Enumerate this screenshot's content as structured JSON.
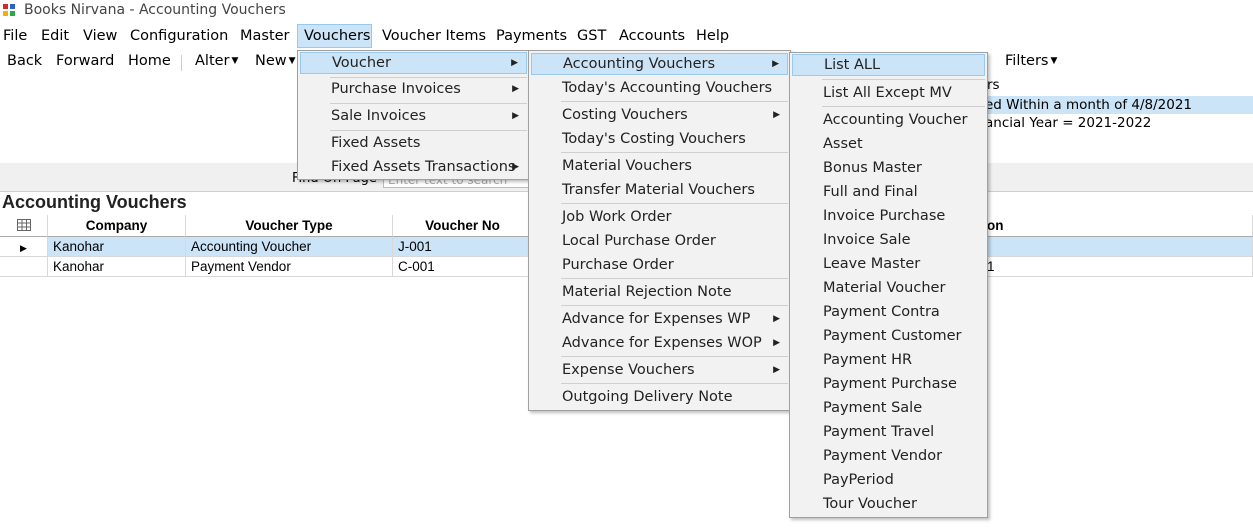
{
  "window": {
    "title": "Books Nirvana - Accounting Vouchers"
  },
  "menubar": [
    "File",
    "Edit",
    "View",
    "Configuration",
    "Master",
    "Vouchers",
    "Voucher Items",
    "Payments",
    "GST",
    "Accounts",
    "Help"
  ],
  "toolbar": {
    "back": "Back",
    "forward": "Forward",
    "home": "Home",
    "alter": "Alter",
    "new": "New",
    "filters": "Filters"
  },
  "filters": {
    "line1": "rs",
    "line2": "ed Within a month of 4/8/2021",
    "line3": "ancial Year = 2021-2022"
  },
  "find": {
    "label": "Find On Page",
    "placeholder": "Enter text to search"
  },
  "section_title": "Accounting Vouchers",
  "grid": {
    "headers": [
      "Company",
      "Voucher Type",
      "Voucher No",
      "on"
    ],
    "rows": [
      {
        "company": "Kanohar",
        "type": "Accounting Voucher",
        "no": "J-001",
        "extra": ""
      },
      {
        "company": "Kanohar",
        "type": "Payment Vendor",
        "no": "C-001",
        "extra": "1"
      }
    ]
  },
  "vouchers_menu": [
    "Voucher",
    "Purchase Invoices",
    "Sale Invoices",
    "Fixed Assets",
    "Fixed Assets Transactions"
  ],
  "voucher_submenu": [
    "Accounting Vouchers",
    "Today's Accounting Vouchers",
    "Costing Vouchers",
    "Today's Costing Vouchers",
    "Material Vouchers",
    "Transfer Material Vouchers",
    "Job Work Order",
    "Local Purchase Order",
    "Purchase Order",
    "Material Rejection Note",
    "Advance for Expenses WP",
    "Advance for Expenses WOP",
    "Expense Vouchers",
    "Outgoing Delivery Note"
  ],
  "accounting_submenu": [
    "List ALL",
    "List All Except MV",
    "Accounting Voucher",
    "Asset",
    "Bonus Master",
    "Full and Final",
    "Invoice Purchase",
    "Invoice Sale",
    "Leave Master",
    "Material Voucher",
    "Payment Contra",
    "Payment Customer",
    "Payment HR",
    "Payment Purchase",
    "Payment Sale",
    "Payment Travel",
    "Payment Vendor",
    "PayPeriod",
    "Tour Voucher"
  ]
}
